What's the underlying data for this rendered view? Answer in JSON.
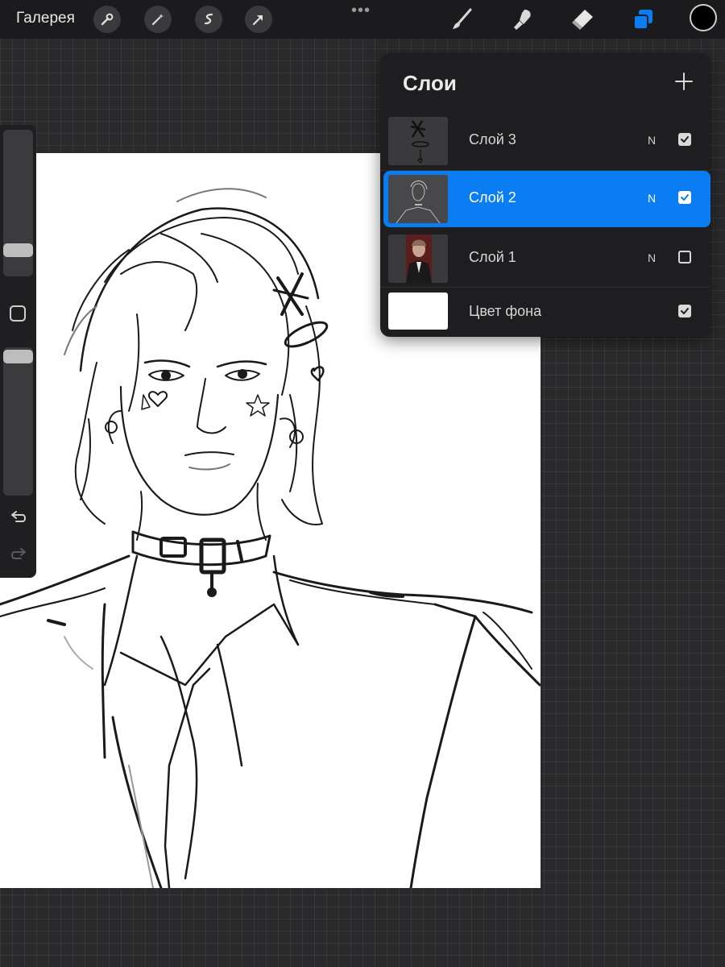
{
  "topbar": {
    "gallery_label": "Галерея",
    "left_tools": [
      "wrench-icon",
      "magic-wand-icon",
      "selection-icon",
      "transform-arrow-icon"
    ],
    "more_menu": "•••",
    "right_tools": [
      "brush-icon",
      "smudge-icon",
      "eraser-icon",
      "layers-icon"
    ],
    "active_tool": "layers-icon",
    "current_color": "#000000",
    "accent_color": "#0b7df2"
  },
  "sidebar": {
    "brush_size_level": 0.23,
    "opacity_level": 0.06,
    "icons": [
      "modify-square-icon",
      "undo-icon",
      "redo-icon"
    ]
  },
  "layers_panel": {
    "title": "Слои",
    "add_icon": "plus-icon",
    "layers": [
      {
        "name": "Слой 3",
        "mode": "N",
        "visible": true,
        "selected": false
      },
      {
        "name": "Слой 2",
        "mode": "N",
        "visible": true,
        "selected": true
      },
      {
        "name": "Слой 1",
        "mode": "N",
        "visible": false,
        "selected": false
      },
      {
        "name": "Цвет фона",
        "mode": "",
        "visible": true,
        "selected": false
      }
    ]
  }
}
